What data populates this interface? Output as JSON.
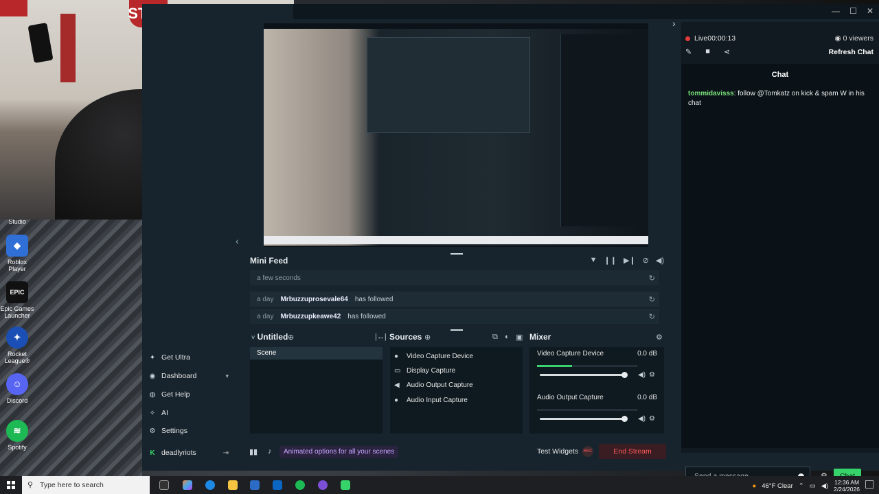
{
  "desktop": {
    "icons": [
      {
        "label": "Studio",
        "color": "#444"
      },
      {
        "label": "Roblox Player",
        "color": "#2f6fd6"
      },
      {
        "label": "Epic Games Launcher",
        "color": "#111"
      },
      {
        "label": "Rocket League®",
        "color": "#1b4fb5"
      },
      {
        "label": "Discord",
        "color": "#5865f2"
      },
      {
        "label": "Spotify",
        "color": "#1db954"
      }
    ]
  },
  "webcam": {
    "sign_text": "STOP"
  },
  "nav": {
    "items": [
      {
        "label": "Get Ultra",
        "icon": "sparkle-icon"
      },
      {
        "label": "Dashboard",
        "icon": "dashboard-icon"
      },
      {
        "label": "Get Help",
        "icon": "help-icon"
      },
      {
        "label": "AI",
        "icon": "ai-icon"
      },
      {
        "label": "Settings",
        "icon": "gear-icon"
      }
    ],
    "user": "deadlyriots"
  },
  "minifeed": {
    "title": "Mini Feed",
    "rows": [
      {
        "time": "a few seconds",
        "name": "",
        "action": ""
      },
      {
        "time": "a day",
        "name": "Mrbuzzuprosevale64",
        "action": "has followed"
      },
      {
        "time": "a day",
        "name": "Mrbuzzupkeawe42",
        "action": "has followed"
      }
    ]
  },
  "scenes": {
    "title": "Untitled",
    "items": [
      "Scene"
    ]
  },
  "sources": {
    "title": "Sources",
    "items": [
      {
        "label": "Video Capture Device",
        "icon": "camera-icon"
      },
      {
        "label": "Display Capture",
        "icon": "monitor-icon"
      },
      {
        "label": "Audio Output Capture",
        "icon": "speaker-icon"
      },
      {
        "label": "Audio Input Capture",
        "icon": "mic-icon"
      }
    ]
  },
  "mixer": {
    "title": "Mixer",
    "channels": [
      {
        "label": "Video Capture Device",
        "db": "0.0 dB",
        "level": 0.35,
        "volume": 1.0
      },
      {
        "label": "Audio Output Capture",
        "db": "0.0 dB",
        "level": 0.0,
        "volume": 1.0
      }
    ]
  },
  "bottombar": {
    "promo": "Animated options for all your scenes",
    "test_widgets": "Test Widgets",
    "rec": "REC",
    "end_stream": "End Stream"
  },
  "chat": {
    "live_label": "Live",
    "live_time": "00:00:13",
    "viewers": "0 viewers",
    "refresh": "Refresh Chat",
    "title": "Chat",
    "message_user": "tommidavisss",
    "message_text": ": follow @Tomkatz on kick & spam W in his chat",
    "input_placeholder": "Send a message",
    "send_label": "Chat",
    "accent": "#36d36a"
  },
  "taskbar": {
    "search_placeholder": "Type here to search",
    "weather": "46°F  Clear",
    "time": "12:36 AM",
    "date": "2/24/2026"
  }
}
